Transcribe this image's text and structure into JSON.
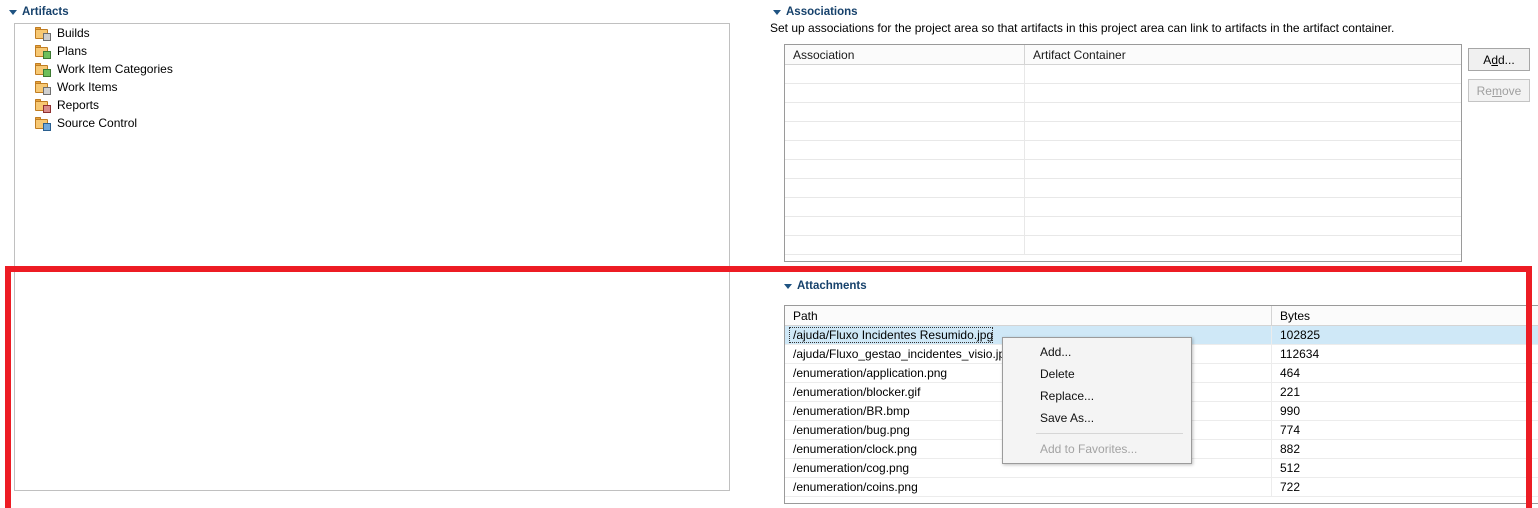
{
  "left_panel": {
    "section_title": "Artifacts",
    "tree_items": [
      {
        "label": "Builds",
        "icon": "folder-builds-icon",
        "overlay": "gray"
      },
      {
        "label": "Plans",
        "icon": "folder-plans-icon",
        "overlay": "green"
      },
      {
        "label": "Work Item Categories",
        "icon": "folder-work-item-categories-icon",
        "overlay": "green"
      },
      {
        "label": "Work Items",
        "icon": "folder-work-items-icon",
        "overlay": "gray"
      },
      {
        "label": "Reports",
        "icon": "folder-reports-icon",
        "overlay": "red"
      },
      {
        "label": "Source Control",
        "icon": "folder-source-control-icon",
        "overlay": "blue"
      }
    ]
  },
  "associations": {
    "section_title": "Associations",
    "description": "Set up associations for the project area so that artifacts in this project area can link to artifacts in the artifact container.",
    "columns": [
      "Association",
      "Artifact Container"
    ],
    "rows": [],
    "empty_row_count": 10,
    "buttons": [
      {
        "label": "Add...",
        "mnemonic": "d",
        "enabled": true
      },
      {
        "label": "Remove",
        "mnemonic": "m",
        "enabled": false
      }
    ]
  },
  "attachments": {
    "section_title": "Attachments",
    "columns": [
      "Path",
      "Bytes"
    ],
    "rows": [
      {
        "path": "/ajuda/Fluxo Incidentes Resumido.jpg",
        "bytes": "102825",
        "selected": true
      },
      {
        "path": "/ajuda/Fluxo_gestao_incidentes_visio.jpg",
        "bytes": "112634",
        "selected": false
      },
      {
        "path": "/enumeration/application.png",
        "bytes": "464",
        "selected": false
      },
      {
        "path": "/enumeration/blocker.gif",
        "bytes": "221",
        "selected": false
      },
      {
        "path": "/enumeration/BR.bmp",
        "bytes": "990",
        "selected": false
      },
      {
        "path": "/enumeration/bug.png",
        "bytes": "774",
        "selected": false
      },
      {
        "path": "/enumeration/clock.png",
        "bytes": "882",
        "selected": false
      },
      {
        "path": "/enumeration/cog.png",
        "bytes": "512",
        "selected": false
      },
      {
        "path": "/enumeration/coins.png",
        "bytes": "722",
        "selected": false
      }
    ],
    "buttons": [
      {
        "label": "Add...",
        "mnemonic": "d",
        "enabled": true
      },
      {
        "label": "Delete",
        "mnemonic": "e",
        "enabled": true
      },
      {
        "label": "Replace...",
        "mnemonic": "R",
        "enabled": true
      },
      {
        "label": "Save As...",
        "mnemonic": "S",
        "enabled": true
      }
    ],
    "scrollbar": {
      "up_arrow": "▲"
    }
  },
  "context_menu": {
    "items": [
      {
        "label": "Add...",
        "enabled": true,
        "separator_before": false
      },
      {
        "label": "Delete",
        "enabled": true,
        "separator_before": false
      },
      {
        "label": "Replace...",
        "enabled": true,
        "separator_before": false
      },
      {
        "label": "Save As...",
        "enabled": true,
        "separator_before": false
      },
      {
        "label": "Add to Favorites...",
        "enabled": false,
        "separator_before": true
      }
    ]
  },
  "annotation": {
    "color": "#ed1c24",
    "target": "Attachments"
  }
}
